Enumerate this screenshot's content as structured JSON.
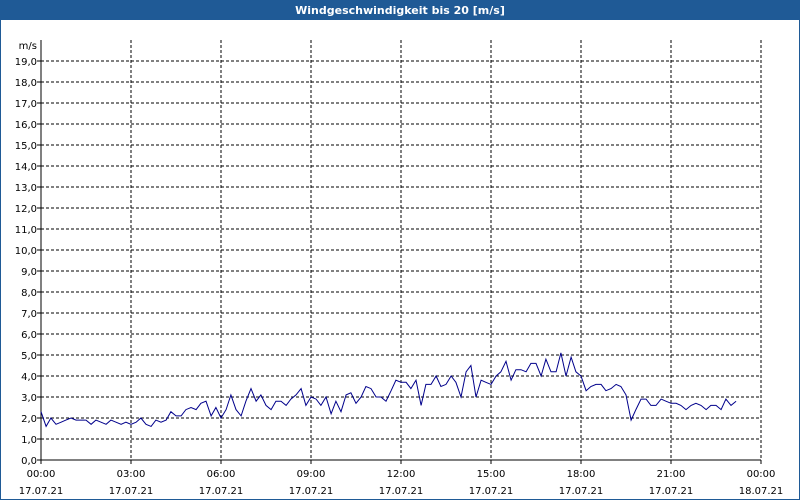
{
  "window": {
    "title": "Windgeschwindigkeit bis 20 [m/s]"
  },
  "colors": {
    "title_bar": "#1f5a96",
    "line": "#00008b",
    "grid": "#000000"
  },
  "chart_data": {
    "type": "line",
    "title": "Windgeschwindigkeit bis 20 [m/s]",
    "ylabel": "m/s",
    "xlabel": "",
    "ylim": [
      0,
      20
    ],
    "yticks": [
      "0,0",
      "1,0",
      "2,0",
      "3,0",
      "4,0",
      "5,0",
      "6,0",
      "7,0",
      "8,0",
      "9,0",
      "10,0",
      "11,0",
      "12,0",
      "13,0",
      "14,0",
      "15,0",
      "16,0",
      "17,0",
      "18,0",
      "19,0"
    ],
    "xlim_hours": [
      0,
      24
    ],
    "xticks": [
      {
        "time": "00:00",
        "date": "17.07.21"
      },
      {
        "time": "03:00",
        "date": "17.07.21"
      },
      {
        "time": "06:00",
        "date": "17.07.21"
      },
      {
        "time": "09:00",
        "date": "17.07.21"
      },
      {
        "time": "12:00",
        "date": "17.07.21"
      },
      {
        "time": "15:00",
        "date": "17.07.21"
      },
      {
        "time": "18:00",
        "date": "17.07.21"
      },
      {
        "time": "21:00",
        "date": "17.07.21"
      },
      {
        "time": "00:00",
        "date": "18.07.21"
      }
    ],
    "grid": true,
    "series": [
      {
        "x_hours": [
          0.0,
          0.17,
          0.33,
          0.5,
          0.67,
          0.83,
          1.0,
          1.17,
          1.33,
          1.5,
          1.67,
          1.83,
          2.0,
          2.17,
          2.33,
          2.5,
          2.67,
          2.83,
          3.0,
          3.17,
          3.33,
          3.5,
          3.67,
          3.83,
          4.0,
          4.17,
          4.33,
          4.5,
          4.67,
          4.83,
          5.0,
          5.17,
          5.33,
          5.5,
          5.67,
          5.83,
          6.0,
          6.17,
          6.33,
          6.5,
          6.67,
          6.83,
          7.0,
          7.17,
          7.33,
          7.5,
          7.67,
          7.83,
          8.0,
          8.17,
          8.33,
          8.5,
          8.67,
          8.83,
          9.0,
          9.17,
          9.33,
          9.5,
          9.67,
          9.83,
          10.0,
          10.17,
          10.33,
          10.5,
          10.67,
          10.83,
          11.0,
          11.17,
          11.33,
          11.5,
          11.67,
          11.83,
          12.0,
          12.17,
          12.33,
          12.5,
          12.67,
          12.83,
          13.0,
          13.17,
          13.33,
          13.5,
          13.67,
          13.83,
          14.0,
          14.17,
          14.33,
          14.5,
          14.67,
          14.83,
          15.0,
          15.17,
          15.33,
          15.5,
          15.67,
          15.83,
          16.0,
          16.17,
          16.33,
          16.5,
          16.67,
          16.83,
          17.0,
          17.17,
          17.33,
          17.5,
          17.67,
          17.83,
          18.0,
          18.17,
          18.33,
          18.5,
          18.67,
          18.83,
          19.0,
          19.17,
          19.33,
          19.5,
          19.67,
          19.83,
          20.0,
          20.17,
          20.33,
          20.5,
          20.67,
          20.83,
          21.0,
          21.17,
          21.33,
          21.5,
          21.67,
          21.83,
          22.0,
          22.17,
          22.33,
          22.5,
          22.67,
          22.83,
          23.0,
          23.17,
          23.33,
          23.5,
          23.67,
          23.83
        ],
        "values": [
          2.3,
          1.6,
          2.0,
          1.7,
          1.8,
          1.9,
          2.0,
          1.9,
          1.9,
          1.9,
          1.7,
          1.9,
          1.8,
          1.7,
          1.9,
          1.8,
          1.7,
          1.8,
          1.7,
          1.8,
          2.0,
          1.7,
          1.6,
          1.9,
          1.8,
          1.9,
          2.3,
          2.1,
          2.1,
          2.4,
          2.5,
          2.4,
          2.7,
          2.8,
          2.1,
          2.5,
          2.0,
          2.4,
          3.1,
          2.4,
          2.1,
          2.8,
          3.4,
          2.8,
          3.1,
          2.6,
          2.4,
          2.8,
          2.8,
          2.6,
          2.9,
          3.1,
          3.4,
          2.6,
          3.0,
          2.9,
          2.6,
          3.0,
          2.2,
          2.8,
          2.3,
          3.1,
          3.2,
          2.7,
          3.0,
          3.5,
          3.4,
          3.0,
          3.0,
          2.8,
          3.3,
          3.8,
          3.7,
          3.7,
          3.4,
          3.8,
          2.6,
          3.6,
          3.6,
          4.0,
          3.5,
          3.6,
          4.0,
          3.7,
          3.0,
          4.2,
          4.5,
          3.0,
          3.8,
          3.7,
          3.6,
          4.0,
          4.2,
          4.7,
          3.8,
          4.3,
          4.3,
          4.2,
          4.6,
          4.6,
          4.0,
          4.8,
          4.2,
          4.2,
          5.1,
          4.0,
          4.9,
          4.2,
          4.0,
          3.3,
          3.5,
          3.6,
          3.6,
          3.3,
          3.4,
          3.6,
          3.5,
          3.1,
          1.9,
          2.4,
          2.9,
          2.9,
          2.6,
          2.6,
          2.9,
          2.8,
          2.7,
          2.7,
          2.6,
          2.4,
          2.6,
          2.7,
          2.6,
          2.4,
          2.6,
          2.6,
          2.4,
          2.9,
          2.6,
          2.8
        ]
      }
    ]
  }
}
